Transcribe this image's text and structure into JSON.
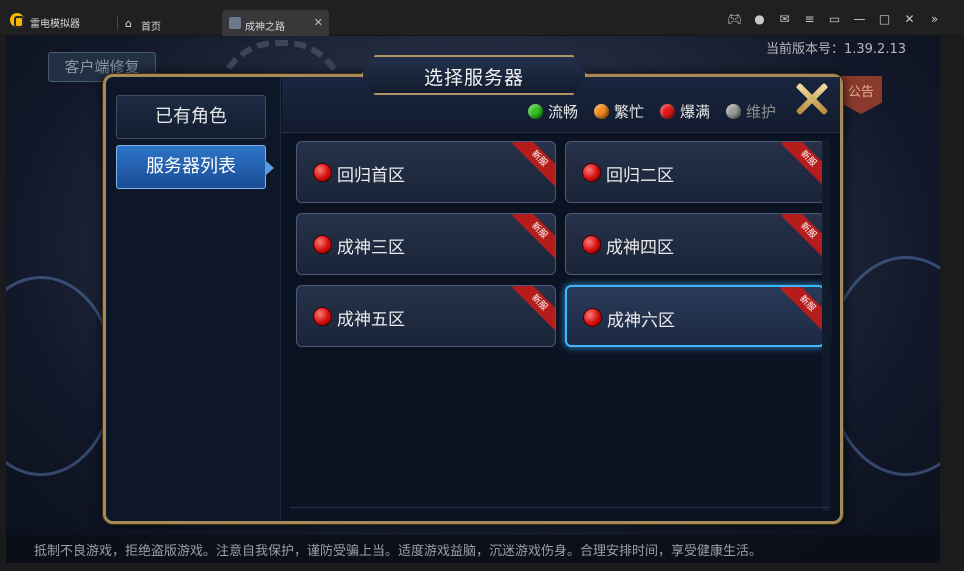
{
  "titlebar": {
    "app_name": "雷电模拟器",
    "home_tab": "首页",
    "game_tab": "成神之路",
    "icons": [
      "gamepad-icon",
      "user-icon",
      "mail-icon",
      "menu-icon",
      "pin-icon",
      "minimize-icon",
      "maximize-icon",
      "close-icon",
      "expand-icon"
    ]
  },
  "game": {
    "version": "当前版本号：1.39.2.13",
    "repair_button": "客户端修复",
    "notice_button": "公告",
    "bottom_tip": "抵制不良游戏，拒绝盗版游戏。注意自我保护，谨防受骗上当。适度游戏益脑，沉迷游戏伤身。合理安排时间，享受健康生活。"
  },
  "dialog": {
    "title": "选择服务器",
    "side_tabs": [
      {
        "label": "已有角色",
        "active": false
      },
      {
        "label": "服务器列表",
        "active": true
      }
    ],
    "legend": [
      {
        "label": "流畅",
        "color": "#34c224"
      },
      {
        "label": "繁忙",
        "color": "#f08a1c"
      },
      {
        "label": "爆满",
        "color": "#e01818"
      },
      {
        "label": "维护",
        "color": "#9a9a9a"
      }
    ],
    "servers": [
      {
        "name": "回归首区",
        "badge": "新服",
        "status": "爆满",
        "selected": false
      },
      {
        "name": "回归二区",
        "badge": "新服",
        "status": "爆满",
        "selected": false
      },
      {
        "name": "成神三区",
        "badge": "新服",
        "status": "爆满",
        "selected": false
      },
      {
        "name": "成神四区",
        "badge": "新服",
        "status": "爆满",
        "selected": false
      },
      {
        "name": "成神五区",
        "badge": "新服",
        "status": "爆满",
        "selected": false
      },
      {
        "name": "成神六区",
        "badge": "新服",
        "status": "爆满",
        "selected": true
      }
    ]
  }
}
